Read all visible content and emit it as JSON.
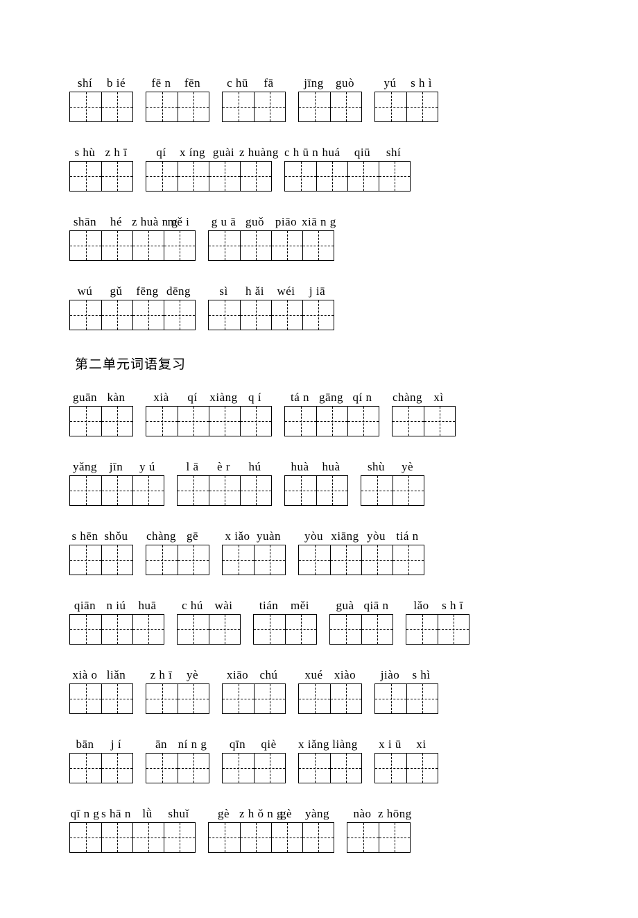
{
  "section_title": "第二单元词语复习",
  "rows": [
    [
      {
        "pinyin": [
          "shí",
          "b ié"
        ],
        "cells": 2
      },
      {
        "pinyin": [
          "fē n",
          "fēn"
        ],
        "cells": 2
      },
      {
        "pinyin": [
          "c hū",
          "fā"
        ],
        "cells": 2
      },
      {
        "pinyin": [
          "jīng",
          "guò"
        ],
        "cells": 2
      },
      {
        "pinyin": [
          "yú",
          "s h ì"
        ],
        "cells": 2
      }
    ],
    [
      {
        "pinyin": [
          "s hù",
          "z h ī"
        ],
        "cells": 2
      },
      {
        "pinyin": [
          "qí",
          "x íng",
          "guài",
          "z huàng"
        ],
        "cells": 4
      },
      {
        "pinyin": [
          "c h ū n",
          "huá",
          "qiū",
          "shí"
        ],
        "cells": 4
      }
    ],
    [
      {
        "pinyin": [
          "shān",
          "hé",
          "z huà n g",
          "mě i"
        ],
        "cells": 4
      },
      {
        "pinyin": [
          "g u ā",
          "guǒ",
          "piāo",
          "xiā n g"
        ],
        "cells": 4
      }
    ],
    [
      {
        "pinyin": [
          "wú",
          "gǔ",
          "fēng",
          "dēng"
        ],
        "cells": 4
      },
      {
        "pinyin": [
          "sì",
          "h ǎi",
          "wéi",
          "j iā"
        ],
        "cells": 4
      }
    ]
  ],
  "rows2": [
    [
      {
        "pinyin": [
          "guān",
          "kàn"
        ],
        "cells": 2
      },
      {
        "pinyin": [
          "xià",
          "qí",
          "xiàng",
          "q í"
        ],
        "cells": 4
      },
      {
        "pinyin": [
          "tá n",
          "gāng",
          "qí n"
        ],
        "cells": 3
      },
      {
        "pinyin": [
          "chàng",
          "xì"
        ],
        "cells": 2
      }
    ],
    [
      {
        "pinyin": [
          "yǎng",
          "jīn",
          "y ú"
        ],
        "cells": 3
      },
      {
        "pinyin": [
          "l ā",
          "è r",
          "hú"
        ],
        "cells": 3
      },
      {
        "pinyin": [
          "huà",
          "huà"
        ],
        "cells": 2
      },
      {
        "pinyin": [
          "shù",
          "yè"
        ],
        "cells": 2
      }
    ],
    [
      {
        "pinyin": [
          "s hēn",
          "shǒu"
        ],
        "cells": 2
      },
      {
        "pinyin": [
          "chàng",
          "gē"
        ],
        "cells": 2
      },
      {
        "pinyin": [
          "x iǎo",
          "yuàn"
        ],
        "cells": 2
      },
      {
        "pinyin": [
          "yòu",
          "xiāng",
          "yòu",
          "tiá n"
        ],
        "cells": 4
      }
    ],
    [
      {
        "pinyin": [
          "qiān",
          "n iú",
          "huā"
        ],
        "cells": 3
      },
      {
        "pinyin": [
          "c hú",
          "wài"
        ],
        "cells": 2
      },
      {
        "pinyin": [
          "tián",
          "měi"
        ],
        "cells": 2
      },
      {
        "pinyin": [
          "guà",
          "qiā n"
        ],
        "cells": 2
      },
      {
        "pinyin": [
          "lǎo",
          "s h ī"
        ],
        "cells": 2
      }
    ],
    [
      {
        "pinyin": [
          "xià o",
          "liǎn"
        ],
        "cells": 2
      },
      {
        "pinyin": [
          "z h ī",
          "yè"
        ],
        "cells": 2
      },
      {
        "pinyin": [
          "xiāo",
          "chú"
        ],
        "cells": 2
      },
      {
        "pinyin": [
          "xué",
          "xiào"
        ],
        "cells": 2
      },
      {
        "pinyin": [
          "jiào",
          "s hì"
        ],
        "cells": 2
      }
    ],
    [
      {
        "pinyin": [
          "bān",
          "j í"
        ],
        "cells": 2
      },
      {
        "pinyin": [
          "ān",
          "ní n g"
        ],
        "cells": 2
      },
      {
        "pinyin": [
          "qīn",
          "qiè"
        ],
        "cells": 2
      },
      {
        "pinyin": [
          "x iǎng",
          "liàng"
        ],
        "cells": 2
      },
      {
        "pinyin": [
          "x i ū",
          "xi"
        ],
        "cells": 2
      }
    ],
    [
      {
        "pinyin": [
          "qī n g",
          "s hā n",
          "lǜ",
          "shuǐ"
        ],
        "cells": 4
      },
      {
        "pinyin": [
          "gè",
          "z h ǒ n g",
          "gè",
          "yàng"
        ],
        "cells": 4
      },
      {
        "pinyin": [
          "nào",
          "z hōng"
        ],
        "cells": 2
      }
    ]
  ]
}
